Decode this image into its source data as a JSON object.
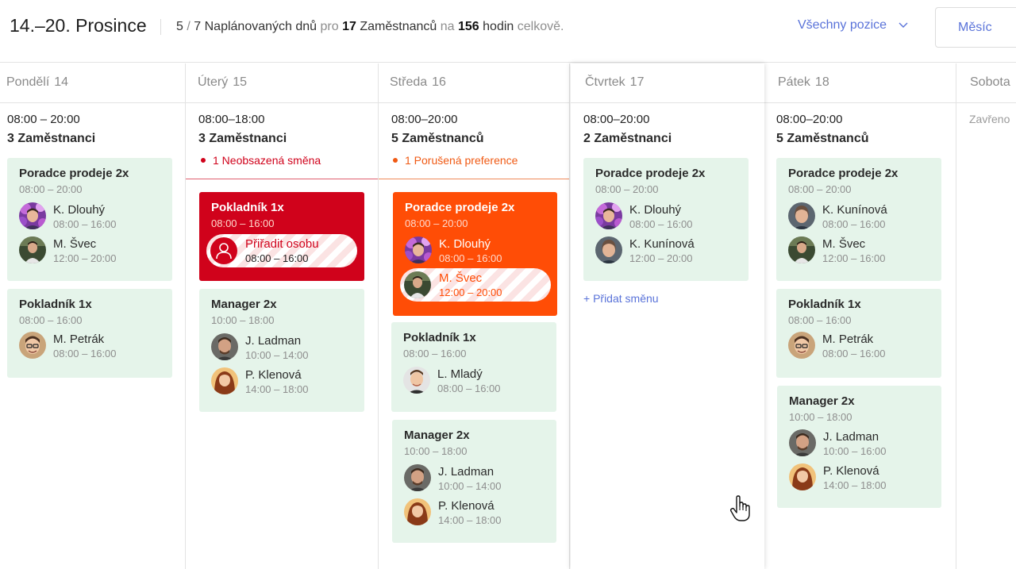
{
  "header": {
    "date_range": "14.–20. Prosince",
    "scheduled_days": "5",
    "days_sep": "/",
    "total_days": "7",
    "scheduled_label": "Naplánovaných dnů",
    "for_label": "pro",
    "employees_count": "17",
    "employees_label": "Zaměstnanců",
    "on_label": "na",
    "hours_count": "156",
    "hours_label": "hodin",
    "total_label": "celkově.",
    "position_filter": "Všechny pozice",
    "view_button": "Měsíc"
  },
  "colors": {
    "accent": "#5a73d9",
    "card_ok": "#e5f4ea",
    "card_unfilled": "#d0021b",
    "card_conflict": "#ff4d06"
  },
  "days": [
    {
      "name": "Pondělí",
      "num": "14",
      "hours": "08:00 – 20:00",
      "count": "3 Zaměstnanci",
      "shifts": [
        {
          "title": "Poradce prodeje 2x",
          "time": "08:00 – 20:00",
          "people": [
            {
              "name": "K. Dlouhý",
              "time": "08:00 – 16:00",
              "avatar": "avatar-k-dlouhy"
            },
            {
              "name": "M. Švec",
              "time": "12:00 – 20:00",
              "avatar": "avatar-m-svec"
            }
          ]
        },
        {
          "title": "Pokladník 1x",
          "time": "08:00 – 16:00",
          "people": [
            {
              "name": "M. Petrák",
              "time": "08:00 – 16:00",
              "avatar": "avatar-m-petrak"
            }
          ]
        }
      ]
    },
    {
      "name": "Úterý",
      "num": "15",
      "hours": "08:00–18:00",
      "count": "3 Zaměstnanci",
      "warning": "1 Neobsazená směna",
      "shifts": [
        {
          "title": "Pokladník 1x",
          "time": "08:00 – 16:00",
          "state": "unfilled",
          "assign": {
            "label": "Přiřadit osobu",
            "time": "08:00 – 16:00",
            "icon": "person-icon"
          }
        },
        {
          "title": "Manager 2x",
          "time": "10:00 – 18:00",
          "people": [
            {
              "name": "J. Ladman",
              "time": "10:00 – 14:00",
              "avatar": "avatar-j-ladman"
            },
            {
              "name": "P. Klenová",
              "time": "14:00 – 18:00",
              "avatar": "avatar-p-klenova"
            }
          ]
        }
      ]
    },
    {
      "name": "Středa",
      "num": "16",
      "hours": "08:00–20:00",
      "count": "5 Zaměstnanců",
      "warning": "1 Porušená preference",
      "shifts": [
        {
          "title": "Poradce prodeje 2x",
          "time": "08:00 – 20:00",
          "state": "conflict",
          "people": [
            {
              "name": "K. Dlouhý",
              "time": "08:00 – 16:00",
              "avatar": "avatar-k-dlouhy"
            }
          ],
          "conflict_person": {
            "name": "M. Švec",
            "time": "12:00 – 20:00",
            "avatar": "avatar-m-svec"
          }
        },
        {
          "title": "Pokladník 1x",
          "time": "08:00 – 16:00",
          "people": [
            {
              "name": "L. Mladý",
              "time": "08:00 – 16:00",
              "avatar": "avatar-l-mlady"
            }
          ]
        },
        {
          "title": "Manager 2x",
          "time": "10:00 – 18:00",
          "people": [
            {
              "name": "J. Ladman",
              "time": "10:00 – 14:00",
              "avatar": "avatar-j-ladman"
            },
            {
              "name": "P. Klenová",
              "time": "14:00 – 18:00",
              "avatar": "avatar-p-klenova"
            }
          ]
        }
      ]
    },
    {
      "name": "Čtvrtek",
      "num": "17",
      "hours": "08:00–20:00",
      "count": "2 Zaměstnanci",
      "add_shift": "+ Přidat směnu",
      "shifts": [
        {
          "title": "Poradce prodeje 2x",
          "time": "08:00 – 20:00",
          "people": [
            {
              "name": "K. Dlouhý",
              "time": "08:00 – 16:00",
              "avatar": "avatar-k-dlouhy"
            },
            {
              "name": "K. Kunínová",
              "time": "12:00 – 20:00",
              "avatar": "avatar-k-kuninova"
            }
          ]
        }
      ]
    },
    {
      "name": "Pátek",
      "num": "18",
      "hours": "08:00–20:00",
      "count": "5 Zaměstnanců",
      "shifts": [
        {
          "title": "Poradce prodeje 2x",
          "time": "08:00 – 20:00",
          "people": [
            {
              "name": "K. Kunínová",
              "time": "08:00 – 16:00",
              "avatar": "avatar-k-kuninova"
            },
            {
              "name": "M. Švec",
              "time": "12:00 – 16:00",
              "avatar": "avatar-m-svec"
            }
          ]
        },
        {
          "title": "Pokladník 1x",
          "time": "08:00 – 16:00",
          "people": [
            {
              "name": "M. Petrák",
              "time": "08:00 – 16:00",
              "avatar": "avatar-m-petrak"
            }
          ]
        },
        {
          "title": "Manager 2x",
          "time": "10:00 – 18:00",
          "people": [
            {
              "name": "J. Ladman",
              "time": "10:00 – 16:00",
              "avatar": "avatar-j-ladman"
            },
            {
              "name": "P. Klenová",
              "time": "14:00 – 18:00",
              "avatar": "avatar-p-klenova"
            }
          ]
        }
      ]
    },
    {
      "name": "Sobota",
      "closed": "Zavřeno",
      "shifts": []
    }
  ]
}
